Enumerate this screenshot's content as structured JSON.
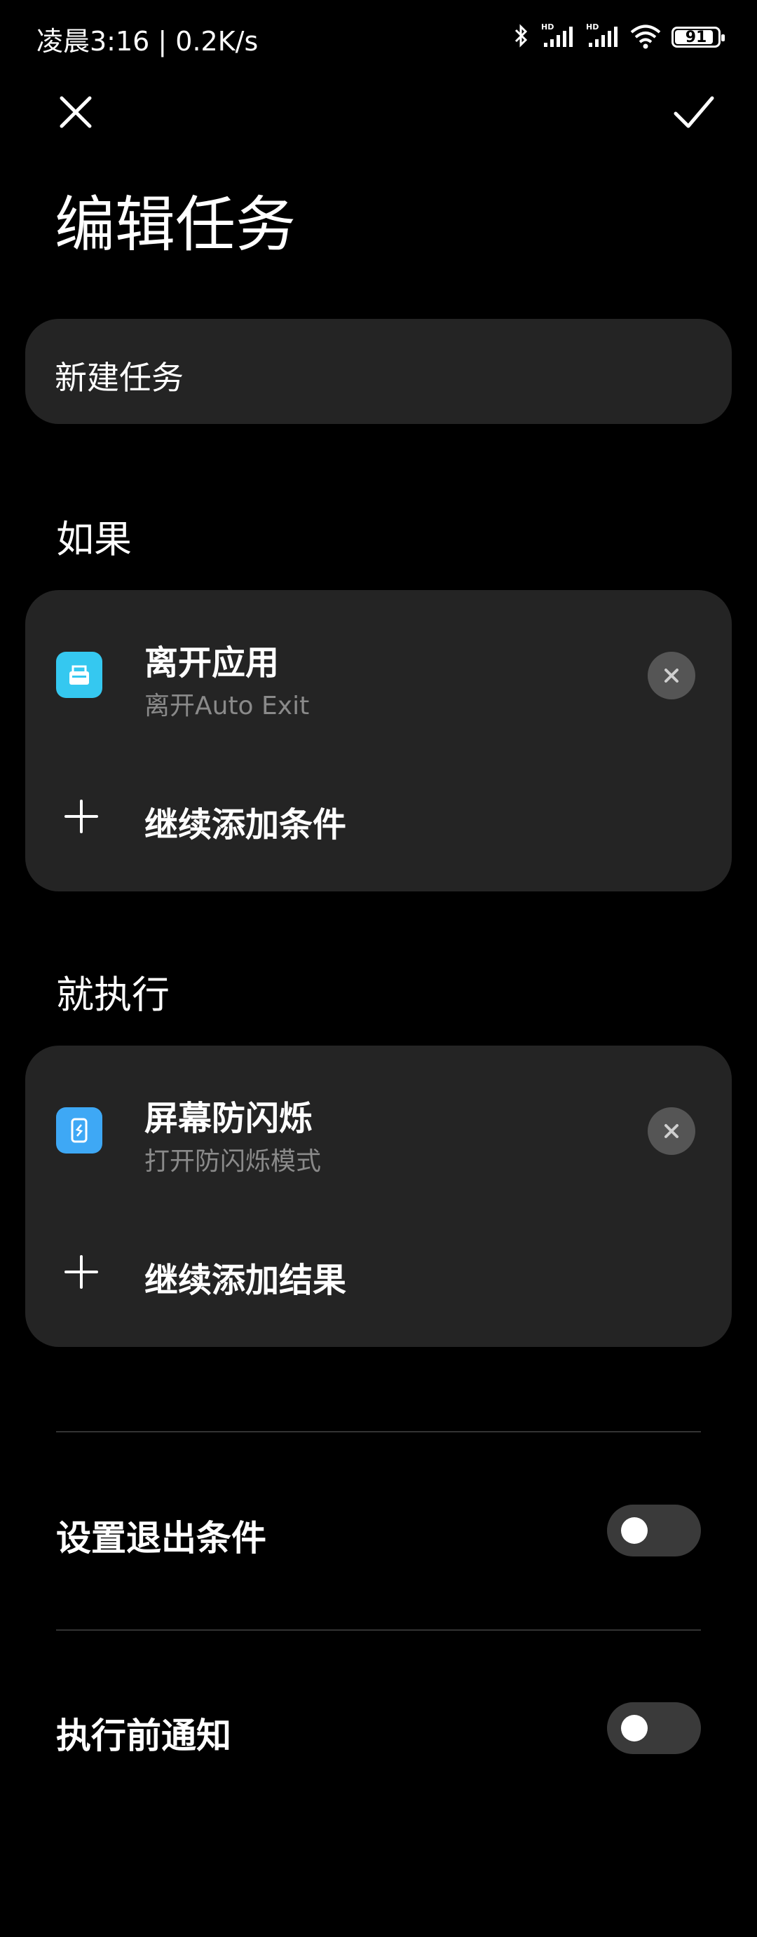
{
  "status_bar": {
    "time_speed": "凌晨3:16 | 0.2K/s",
    "battery": "91",
    "battery_level": 0.91,
    "icons": [
      "bluetooth-icon",
      "signal-hd-icon",
      "signal-hd-icon",
      "wifi-icon",
      "battery-icon"
    ]
  },
  "header": {
    "close_icon": "close-icon",
    "confirm_icon": "check-icon",
    "title": "编辑任务"
  },
  "task_name": "新建任务",
  "conditions": {
    "label": "如果",
    "items": [
      {
        "title": "离开应用",
        "subtitle": "离开Auto Exit",
        "icon": "app-exit-icon",
        "icon_color": "#35c8f0"
      }
    ],
    "add_label": "继续添加条件"
  },
  "actions": {
    "label": "就执行",
    "items": [
      {
        "title": "屏幕防闪烁",
        "subtitle": "打开防闪烁模式",
        "icon": "screen-flicker-icon",
        "icon_color": "#3ea8f5"
      }
    ],
    "add_label": "继续添加结果"
  },
  "settings": [
    {
      "label": "设置退出条件",
      "enabled": false
    },
    {
      "label": "执行前通知",
      "enabled": false
    }
  ],
  "colors": {
    "background": "#000000",
    "card": "#242424",
    "toggle_off": "#3a3a3a"
  }
}
